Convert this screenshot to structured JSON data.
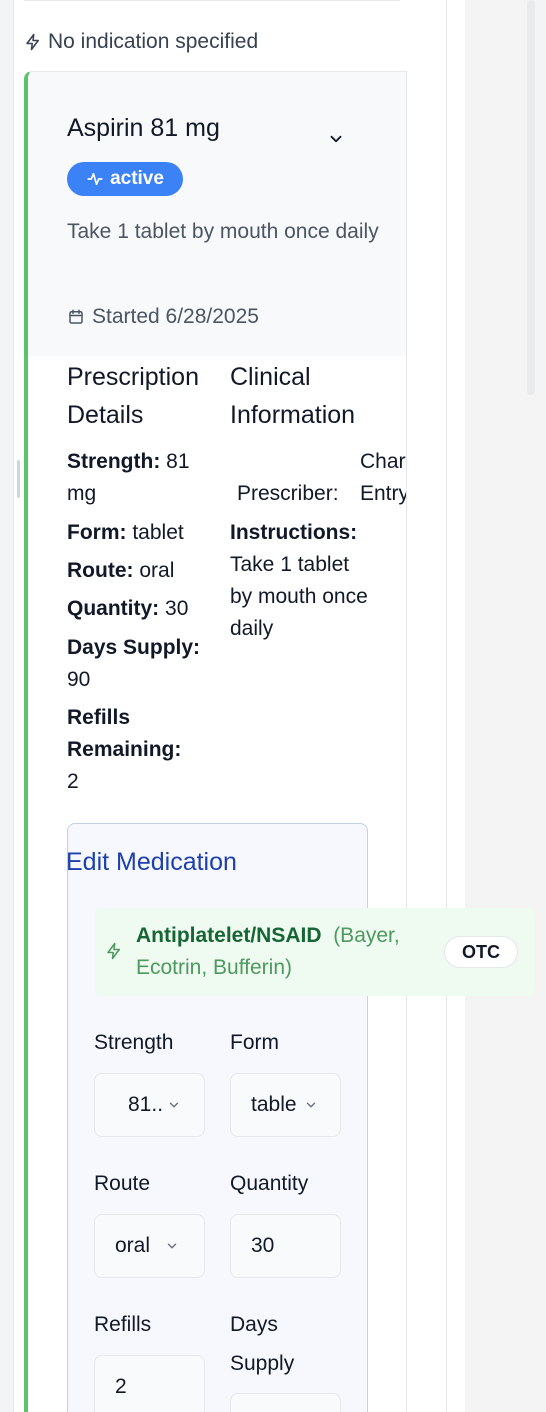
{
  "indication": {
    "text": "No indication specified",
    "icon": "lightning-icon"
  },
  "medication": {
    "name": "Aspirin 81 mg",
    "status": "active",
    "instructions": "Take 1 tablet by mouth once daily",
    "started": "Started 6/28/2025"
  },
  "prescription_details": {
    "title": "Prescription Details",
    "strength_label": "Strength:",
    "strength_value": "81 mg",
    "form_label": "Form:",
    "form_value": "tablet",
    "route_label": "Route:",
    "route_value": "oral",
    "quantity_label": "Quantity:",
    "quantity_value": "30",
    "days_supply_label": "Days Supply:",
    "days_supply_value": "90",
    "refills_label": "Refills Remaining:",
    "refills_value": "2"
  },
  "clinical_information": {
    "title": "Clinical Information",
    "prescriber_label": "Prescriber:",
    "prescriber_value": "Chart Entry",
    "instructions_label": "Instructions:",
    "instructions_value": "Take 1 tablet by mouth once daily"
  },
  "edit": {
    "title": "Edit Medication",
    "drug_class": "Antiplatelet/NSAID",
    "brands": "(Bayer, Ecotrin, Bufferin)",
    "otc_badge": "OTC",
    "fields": {
      "strength": {
        "label": "Strength",
        "value": "81.."
      },
      "form": {
        "label": "Form",
        "value": "table"
      },
      "route": {
        "label": "Route",
        "value": "oral"
      },
      "quantity": {
        "label": "Quantity",
        "value": "30"
      },
      "refills": {
        "label": "Refills",
        "value": "2"
      },
      "days_supply": {
        "label": "Days Supply",
        "value": ""
      }
    }
  },
  "colors": {
    "accent_green": "#5cc26b",
    "status_blue": "#3b82f6",
    "edit_title_blue": "#1e40af"
  }
}
